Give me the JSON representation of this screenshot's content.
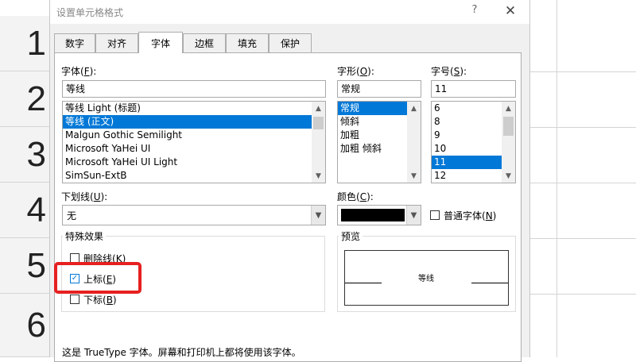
{
  "sheet": {
    "row_numbers": [
      "1",
      "2",
      "3",
      "4",
      "5",
      "6"
    ]
  },
  "dialog": {
    "title": "设置单元格格式",
    "help_icon": "?",
    "close_icon": "✕",
    "tabs": [
      {
        "label": "数字"
      },
      {
        "label": "对齐"
      },
      {
        "label": "字体",
        "active": true
      },
      {
        "label": "边框"
      },
      {
        "label": "填充"
      },
      {
        "label": "保护"
      }
    ],
    "font": {
      "label": "字体(",
      "hotkey": "F",
      "label_end": "):",
      "value": "等线",
      "items": [
        "等线 Light (标题)",
        "等线 (正文)",
        "Malgun Gothic Semilight",
        "Microsoft YaHei UI",
        "Microsoft YaHei UI Light",
        "SimSun-ExtB"
      ],
      "selected_index": 1
    },
    "style": {
      "label": "字形(",
      "hotkey": "O",
      "label_end": "):",
      "value": "常规",
      "items": [
        "常规",
        "倾斜",
        "加粗",
        "加粗 倾斜"
      ],
      "selected_index": 0
    },
    "size": {
      "label": "字号(",
      "hotkey": "S",
      "label_end": "):",
      "value": "11",
      "items": [
        "6",
        "8",
        "9",
        "10",
        "11",
        "12"
      ],
      "selected_index": 4
    },
    "underline": {
      "label": "下划线(",
      "hotkey": "U",
      "label_end": "):",
      "value": "无"
    },
    "color": {
      "label": "颜色(",
      "hotkey": "C",
      "label_end": "):",
      "swatch": "#000000"
    },
    "normal_font": {
      "label": "普通字体(",
      "hotkey": "N",
      "label_end": ")",
      "checked": false
    },
    "effects": {
      "title": "特殊效果",
      "strikethrough": {
        "label": "删除线(",
        "hotkey": "K",
        "label_end": ")",
        "checked": false
      },
      "superscript": {
        "label": "上标(",
        "hotkey": "E",
        "label_end": ")",
        "checked": true
      },
      "subscript": {
        "label": "下标(",
        "hotkey": "B",
        "label_end": ")",
        "checked": false
      }
    },
    "preview": {
      "title": "预览",
      "sample": "等线"
    },
    "footer_note": "这是 TrueType 字体。屏幕和打印机上都将使用该字体。",
    "highlight_color": "#e62020",
    "selection_color": "#0078d7"
  }
}
